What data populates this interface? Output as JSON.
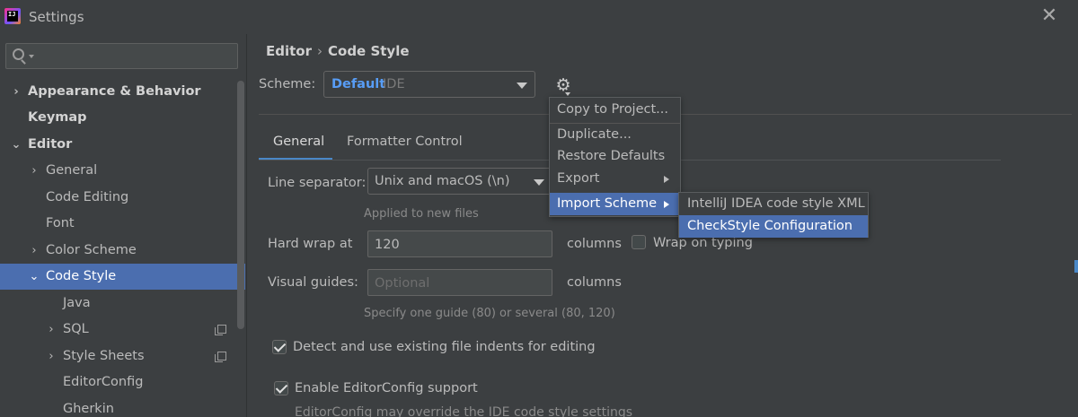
{
  "window": {
    "title": "Settings",
    "close_glyph": "✕",
    "app_icon_text": "IJ"
  },
  "search": {
    "value": "",
    "placeholder": ""
  },
  "sidebar": {
    "items": [
      {
        "label": "Appearance & Behavior",
        "level": 0,
        "expandable": true,
        "expanded": false,
        "bold": true
      },
      {
        "label": "Keymap",
        "level": 0,
        "expandable": false,
        "bold": true
      },
      {
        "label": "Editor",
        "level": 0,
        "expandable": true,
        "expanded": true,
        "bold": true
      },
      {
        "label": "General",
        "level": 1,
        "expandable": true,
        "expanded": false
      },
      {
        "label": "Code Editing",
        "level": 1,
        "expandable": false
      },
      {
        "label": "Font",
        "level": 1,
        "expandable": false
      },
      {
        "label": "Color Scheme",
        "level": 1,
        "expandable": true,
        "expanded": false
      },
      {
        "label": "Code Style",
        "level": 1,
        "expandable": true,
        "expanded": true,
        "selected": true
      },
      {
        "label": "Java",
        "level": 2,
        "expandable": false
      },
      {
        "label": "SQL",
        "level": 2,
        "expandable": true,
        "expanded": false,
        "copy_icon": true
      },
      {
        "label": "Style Sheets",
        "level": 2,
        "expandable": true,
        "expanded": false,
        "copy_icon": true
      },
      {
        "label": "EditorConfig",
        "level": 2,
        "expandable": false
      },
      {
        "label": "Gherkin",
        "level": 2,
        "expandable": false
      }
    ]
  },
  "breadcrumb": {
    "parent": "Editor",
    "separator": "›",
    "current": "Code Style"
  },
  "scheme": {
    "label": "Scheme:",
    "name": "Default",
    "type": "IDE"
  },
  "gear_glyph": "⚙",
  "tabs": [
    {
      "label": "General",
      "active": true
    },
    {
      "label": "Formatter Control",
      "active": false
    }
  ],
  "line_separator": {
    "label": "Line separator:",
    "value": "Unix and macOS (\\n)",
    "hint": "Applied to new files"
  },
  "hard_wrap": {
    "label": "Hard wrap at",
    "value": "120",
    "units": "columns",
    "wrap_on_typing_label": "Wrap on typing",
    "wrap_on_typing_checked": false
  },
  "visual_guides": {
    "label": "Visual guides:",
    "placeholder": "Optional",
    "units": "columns",
    "hint": "Specify one guide (80) or several (80, 120)"
  },
  "detect_indents": {
    "label": "Detect and use existing file indents for editing",
    "checked": true
  },
  "editorconfig": {
    "label": "Enable EditorConfig support",
    "checked": true,
    "hint": "EditorConfig may override the IDE code style settings"
  },
  "gear_menu": {
    "items": [
      {
        "label": "Copy to Project..."
      },
      {
        "label": "Duplicate..."
      },
      {
        "label": "Restore Defaults"
      },
      {
        "label": "Export",
        "submenu": true
      },
      {
        "label": "Import Scheme",
        "submenu": true,
        "active": true
      }
    ]
  },
  "import_submenu": {
    "items": [
      {
        "label": "IntelliJ IDEA code style XML"
      },
      {
        "label": "CheckStyle Configuration",
        "active": true
      }
    ]
  },
  "colors": {
    "selection": "#4b6eaf",
    "link_blue": "#589df6",
    "background": "#3c3f41",
    "tab_underline": "#4a88c7"
  }
}
